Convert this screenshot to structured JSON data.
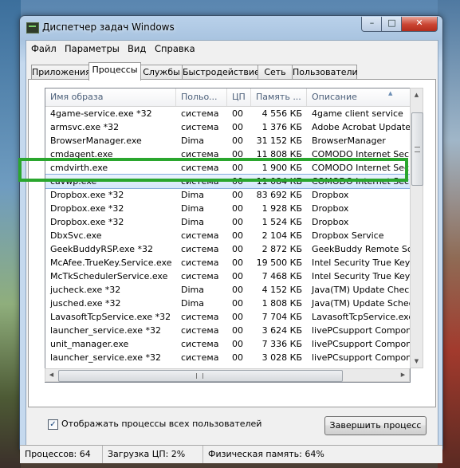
{
  "window": {
    "title": "Диспетчер задач Windows",
    "min": "–",
    "max": "□",
    "close": "✕"
  },
  "menu": [
    "Файл",
    "Параметры",
    "Вид",
    "Справка"
  ],
  "tabs": [
    "Приложения",
    "Процессы",
    "Службы",
    "Быстродействие",
    "Сеть",
    "Пользователи"
  ],
  "active_tab": "Процессы",
  "columns": [
    "Имя образа",
    "Польo...",
    "ЦП",
    "Память ...",
    "Описание"
  ],
  "rows": [
    {
      "name": "4game-service.exe *32",
      "user": "система",
      "cpu": "00",
      "mem": "4 556 КБ",
      "desc": "4game client service"
    },
    {
      "name": "armsvc.exe *32",
      "user": "система",
      "cpu": "00",
      "mem": "1 376 КБ",
      "desc": "Adobe Acrobat Update Se"
    },
    {
      "name": "BrowserManager.exe",
      "user": "Dima",
      "cpu": "00",
      "mem": "31 152 КБ",
      "desc": "BrowserManager"
    },
    {
      "name": "cmdagent.exe",
      "user": "система",
      "cpu": "00",
      "mem": "11 808 КБ",
      "desc": "COMODO Internet Securi"
    },
    {
      "name": "cmdvirth.exe",
      "user": "система",
      "cpu": "00",
      "mem": "1 900 КБ",
      "desc": "COMODO Internet Securi"
    },
    {
      "name": "cavwp.exe",
      "user": "система",
      "cpu": "00",
      "mem": "11 084 КБ",
      "desc": "COMODO Internet Securi"
    },
    {
      "name": "Dropbox.exe *32",
      "user": "Dima",
      "cpu": "00",
      "mem": "83 692 КБ",
      "desc": "Dropbox"
    },
    {
      "name": "Dropbox.exe *32",
      "user": "Dima",
      "cpu": "00",
      "mem": "1 928 КБ",
      "desc": "Dropbox"
    },
    {
      "name": "Dropbox.exe *32",
      "user": "Dima",
      "cpu": "00",
      "mem": "1 524 КБ",
      "desc": "Dropbox"
    },
    {
      "name": "DbxSvc.exe",
      "user": "система",
      "cpu": "00",
      "mem": "2 104 КБ",
      "desc": "Dropbox Service"
    },
    {
      "name": "GeekBuddyRSP.exe *32",
      "user": "система",
      "cpu": "00",
      "mem": "2 872 КБ",
      "desc": "GeekBuddy Remote Scree"
    },
    {
      "name": "McAfee.TrueKey.Service.exe",
      "user": "система",
      "cpu": "00",
      "mem": "19 500 КБ",
      "desc": "Intel Security True Key"
    },
    {
      "name": "McTkSchedulerService.exe",
      "user": "система",
      "cpu": "00",
      "mem": "7 468 КБ",
      "desc": "Intel Security True Key"
    },
    {
      "name": "jucheck.exe *32",
      "user": "Dima",
      "cpu": "00",
      "mem": "4 152 КБ",
      "desc": "Java(TM) Update Checke"
    },
    {
      "name": "jusched.exe *32",
      "user": "Dima",
      "cpu": "00",
      "mem": "1 808 КБ",
      "desc": "Java(TM) Update Schedu"
    },
    {
      "name": "LavasoftTcpService.exe *32",
      "user": "система",
      "cpu": "00",
      "mem": "7 704 КБ",
      "desc": "LavasoftTcpService.exe"
    },
    {
      "name": "launcher_service.exe *32",
      "user": "система",
      "cpu": "00",
      "mem": "3 624 КБ",
      "desc": "livePCsupport Componen"
    },
    {
      "name": "unit_manager.exe",
      "user": "система",
      "cpu": "00",
      "mem": "7 336 КБ",
      "desc": "livePCsupport Componen"
    },
    {
      "name": "launcher_service.exe *32",
      "user": "система",
      "cpu": "00",
      "mem": "3 028 КБ",
      "desc": "livePCsupport Componen"
    }
  ],
  "selected_row": 5,
  "checkbox": {
    "label": "Отображать процессы всех пользователей",
    "checked": true,
    "mark": "✓"
  },
  "end_button": "Завершить процесс",
  "status": {
    "processes": "Процессов: 64",
    "cpu": "Загрузка ЦП: 2%",
    "memory": "Физическая память: 64%"
  },
  "colors": {
    "highlight": "#2aa62e",
    "selected": "#d4e7fb",
    "header_text": "#4c607a"
  }
}
